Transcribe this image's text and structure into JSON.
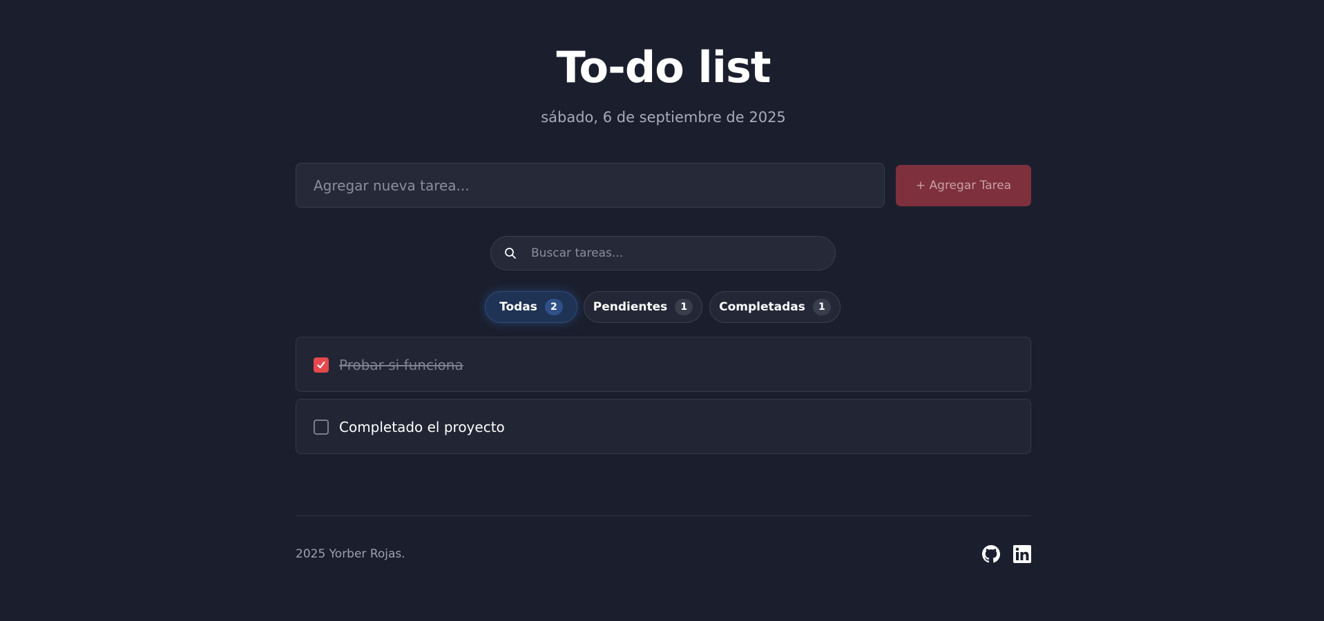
{
  "header": {
    "title": "To-do list",
    "date": "sábado, 6 de septiembre de 2025"
  },
  "new_task": {
    "placeholder": "Agregar nueva tarea...",
    "value": "",
    "button_label": "+ Agregar Tarea"
  },
  "search": {
    "placeholder": "Buscar tareas...",
    "value": "",
    "icon": "search-icon"
  },
  "filters": [
    {
      "label": "Todas",
      "count": "2",
      "active": true
    },
    {
      "label": "Pendientes",
      "count": "1",
      "active": false
    },
    {
      "label": "Completadas",
      "count": "1",
      "active": false
    }
  ],
  "tasks": [
    {
      "text": "Probar si funciona",
      "completed": true
    },
    {
      "text": "Completado el proyecto",
      "completed": false
    }
  ],
  "footer": {
    "copyright": "2025 Yorber Rojas.",
    "links": [
      {
        "icon": "github-icon"
      },
      {
        "icon": "linkedin-icon"
      }
    ]
  },
  "colors": {
    "background": "#1b1f2d",
    "accent": "#e5484d",
    "add_button": "#7e303d",
    "active_filter": "#1f3354"
  }
}
